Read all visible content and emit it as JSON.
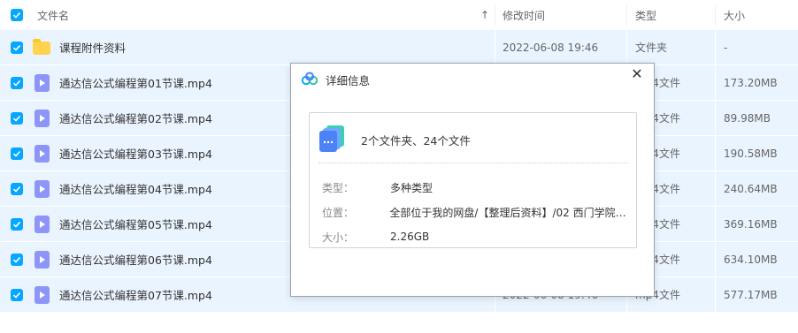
{
  "header": {
    "col_name": "文件名",
    "sort_glyph": "↑",
    "col_time": "修改时间",
    "col_type": "类型",
    "col_size": "大小"
  },
  "files": [
    {
      "name": "课程附件资料",
      "time": "2022-06-08 19:46",
      "type": "文件夹",
      "size": "-",
      "icon": "folder-icon"
    },
    {
      "name": "通达信公式编程第01节课.mp4",
      "time": "",
      "type": "mp4文件",
      "size": "173.20MB",
      "icon": "video-icon"
    },
    {
      "name": "通达信公式编程第02节课.mp4",
      "time": "",
      "type": "mp4文件",
      "size": "89.98MB",
      "icon": "video-icon"
    },
    {
      "name": "通达信公式编程第03节课.mp4",
      "time": "",
      "type": "mp4文件",
      "size": "190.58MB",
      "icon": "video-icon"
    },
    {
      "name": "通达信公式编程第04节课.mp4",
      "time": "",
      "type": "mp4文件",
      "size": "240.64MB",
      "icon": "video-icon"
    },
    {
      "name": "通达信公式编程第05节课.mp4",
      "time": "",
      "type": "mp4文件",
      "size": "369.16MB",
      "icon": "video-icon"
    },
    {
      "name": "通达信公式编程第06节课.mp4",
      "time": "",
      "type": "mp4文件",
      "size": "634.10MB",
      "icon": "video-icon"
    },
    {
      "name": "通达信公式编程第07节课.mp4",
      "time": "2022-06-08 19:46",
      "type": "mp4文件",
      "size": "577.17MB",
      "icon": "video-icon"
    }
  ],
  "dialog": {
    "title": "详细信息",
    "close_glyph": "✕",
    "summary": "2个文件夹、24个文件",
    "type_label": "类型：",
    "type_value": "多种类型",
    "location_label": "位置：",
    "location_value": "全部位于我的网盘/【整理后资料】/02 西门学院/...",
    "size_label": "大小：",
    "size_value": "2.26GB"
  },
  "colors": {
    "accent": "#06a7ff",
    "row_selected": "#eaf4fe",
    "folder": "#ffd34e",
    "video": "#8e95f8"
  }
}
